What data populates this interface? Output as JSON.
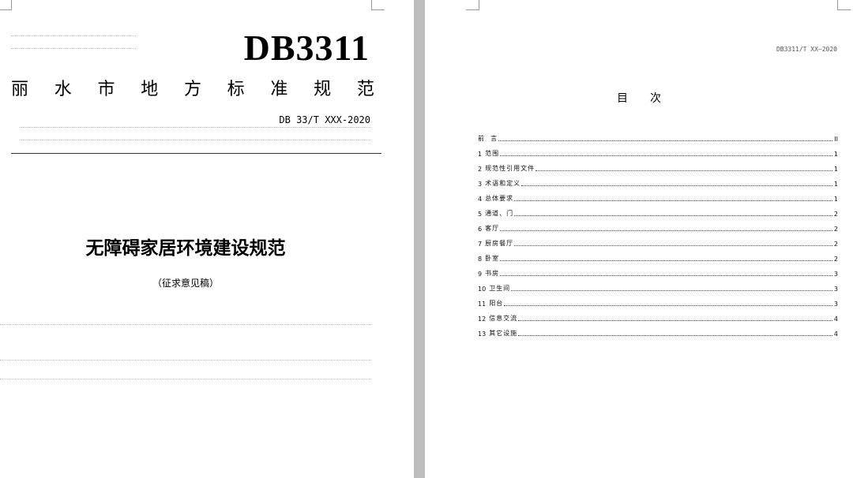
{
  "cover": {
    "code": "DB3311",
    "standard_name_chars": [
      "丽",
      "水",
      "市",
      "地",
      "方",
      "标",
      "准",
      "规",
      "范"
    ],
    "standard_number": "DB 33/T XXX-2020",
    "title": "无障碍家居环境建设规范",
    "subtitle": "（征求意见稿）"
  },
  "toc_page": {
    "header": "DB3311/T XX—2020",
    "title_chars": [
      "目",
      "次"
    ],
    "entries": [
      {
        "num": "",
        "text": "前  言",
        "page": "II"
      },
      {
        "num": "1",
        "text": "范围",
        "page": "1"
      },
      {
        "num": "2",
        "text": "规范性引用文件",
        "page": "1"
      },
      {
        "num": "3",
        "text": "术语和定义",
        "page": "1"
      },
      {
        "num": "4",
        "text": "总体要求",
        "page": "1"
      },
      {
        "num": "5",
        "text": "通道、门",
        "page": "2"
      },
      {
        "num": "6",
        "text": "客厅",
        "page": "2"
      },
      {
        "num": "7",
        "text": "厨房餐厅",
        "page": "2"
      },
      {
        "num": "8",
        "text": "卧室",
        "page": "2"
      },
      {
        "num": "9",
        "text": "书房",
        "page": "3"
      },
      {
        "num": "10",
        "text": "卫生间",
        "page": "3"
      },
      {
        "num": "11",
        "text": "阳台",
        "page": "3"
      },
      {
        "num": "12",
        "text": "信息交流",
        "page": "4"
      },
      {
        "num": "13",
        "text": "其它设施",
        "page": "4"
      }
    ]
  }
}
